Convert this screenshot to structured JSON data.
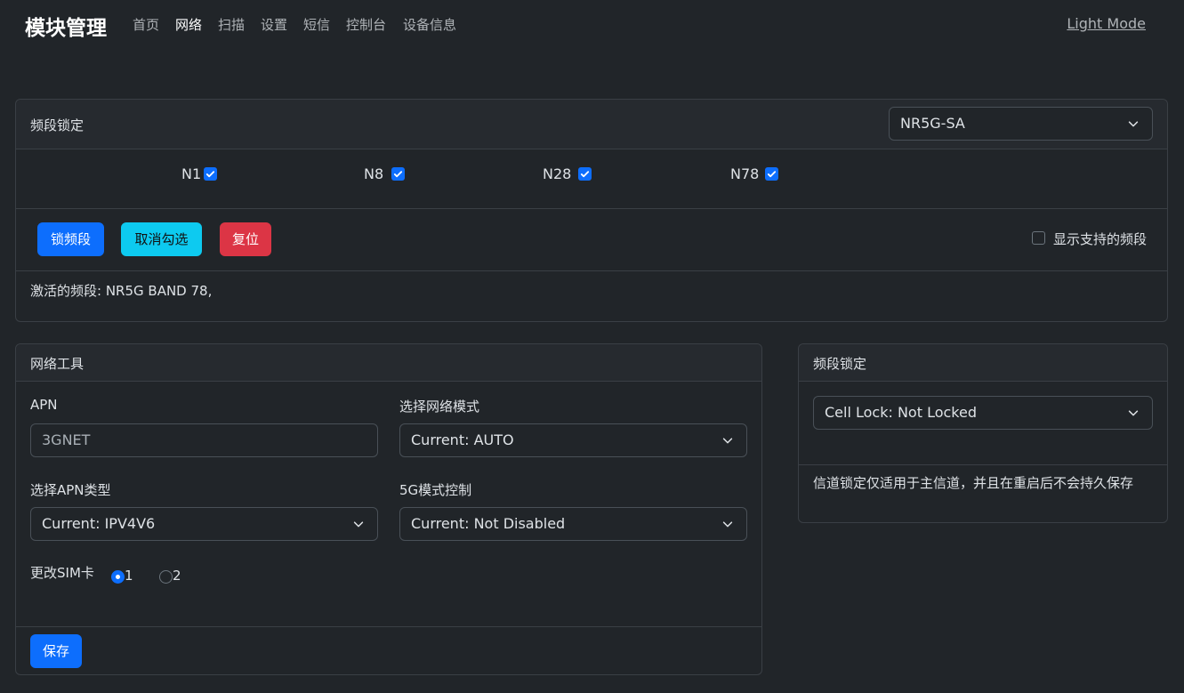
{
  "nav": {
    "brand": "模块管理",
    "items": [
      "首页",
      "网络",
      "扫描",
      "设置",
      "短信",
      "控制台",
      "设备信息"
    ],
    "active": "网络",
    "mode_toggle": "Light Mode"
  },
  "band_lock": {
    "title": "频段锁定",
    "mode_select": "NR5G-SA",
    "bands": [
      {
        "label": "N1",
        "checked": true
      },
      {
        "label": "N8",
        "checked": true
      },
      {
        "label": "N28",
        "checked": true
      },
      {
        "label": "N78",
        "checked": true
      }
    ],
    "buttons": {
      "lock": "锁频段",
      "uncheck": "取消勾选",
      "reset": "复位"
    },
    "show_supported_label": "显示支持的频段",
    "show_supported_checked": false,
    "active_bands": "激活的频段: NR5G BAND 78,"
  },
  "network_tools": {
    "title": "网络工具",
    "apn_label": "APN",
    "apn_value": "3GNET",
    "network_mode_label": "选择网络模式",
    "network_mode_value": "Current: AUTO",
    "apn_type_label": "选择APN类型",
    "apn_type_value": "Current: IPV4V6",
    "nr5g_control_label": "5G模式控制",
    "nr5g_control_value": "Current: Not Disabled",
    "sim_label": "更改SIM卡",
    "sim_options": [
      "1",
      "2"
    ],
    "sim_selected": "1",
    "save_label": "保存"
  },
  "cell_lock": {
    "title": "频段锁定",
    "select_value": "Cell Lock: Not Locked",
    "note": "信道锁定仅适用于主信道，并且在重启后不会持久保存"
  },
  "colors": {
    "background": "#212529",
    "primary": "#0d6efd",
    "info": "#0dcaf0",
    "danger": "#dc3545"
  }
}
